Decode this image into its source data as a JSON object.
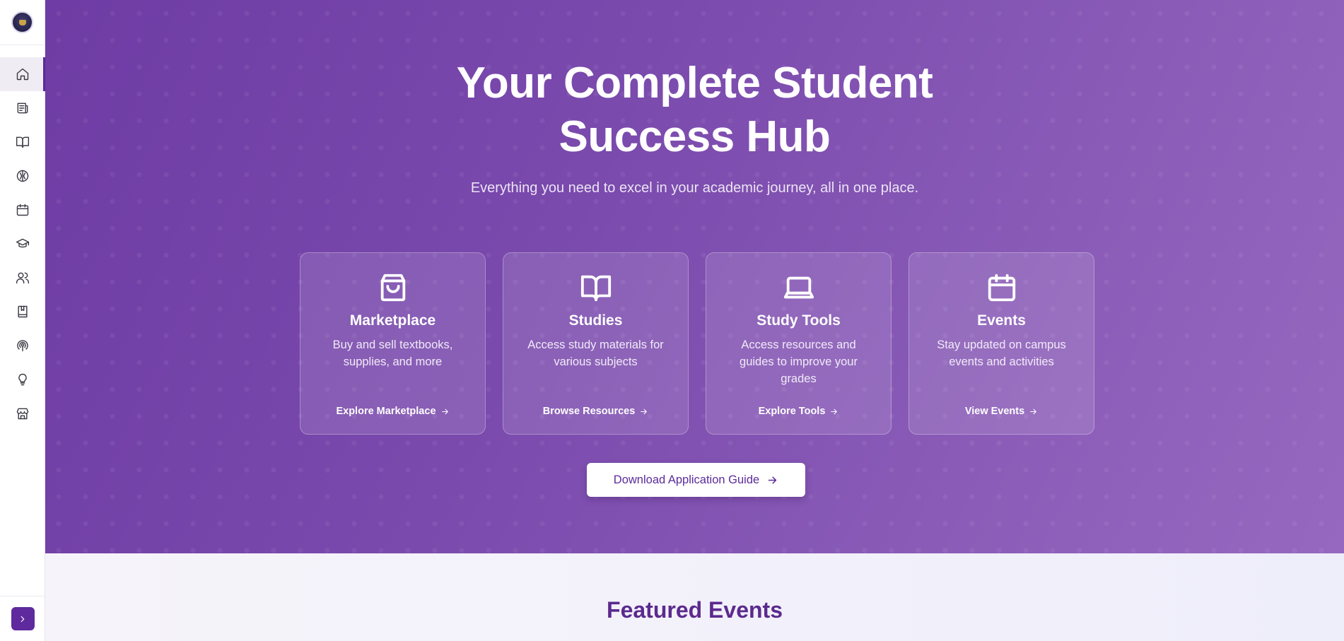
{
  "sidebar": {
    "logo_icon": "university-crest-logo",
    "items": [
      {
        "name": "home",
        "icon": "home-icon",
        "active": true
      },
      {
        "name": "news",
        "icon": "newspaper-icon",
        "active": false
      },
      {
        "name": "studies",
        "icon": "book-open-icon",
        "active": false
      },
      {
        "name": "brain",
        "icon": "brain-icon",
        "active": false
      },
      {
        "name": "calendar",
        "icon": "calendar-icon",
        "active": false
      },
      {
        "name": "graduation",
        "icon": "graduation-cap-icon",
        "active": false
      },
      {
        "name": "users",
        "icon": "users-icon",
        "active": false
      },
      {
        "name": "bookmark-book",
        "icon": "book-bookmark-icon",
        "active": false
      },
      {
        "name": "podcast",
        "icon": "podcast-icon",
        "active": false
      },
      {
        "name": "ideas",
        "icon": "lightbulb-icon",
        "active": false
      },
      {
        "name": "store",
        "icon": "store-icon",
        "active": false
      }
    ],
    "expand_icon": "chevron-right-icon"
  },
  "hero": {
    "title_line1": "Your Complete Student",
    "title_line2": "Success Hub",
    "subtitle": "Everything you need to excel in your academic journey, all in one place.",
    "cards": [
      {
        "icon": "shopping-bag-icon",
        "title": "Marketplace",
        "description": "Buy and sell textbooks, supplies, and more",
        "link": "Explore Marketplace"
      },
      {
        "icon": "book-open-icon",
        "title": "Studies",
        "description": "Access study materials for various subjects",
        "link": "Browse Resources"
      },
      {
        "icon": "laptop-icon",
        "title": "Study Tools",
        "description": "Access resources and guides to improve your grades",
        "link": "Explore Tools"
      },
      {
        "icon": "calendar-icon",
        "title": "Events",
        "description": "Stay updated on campus events and activities",
        "link": "View Events"
      }
    ],
    "guide_button": "Download Application Guide"
  },
  "featured": {
    "title": "Featured Events"
  },
  "colors": {
    "accent": "#5b2a9a",
    "hero_start": "#6e3ca4",
    "hero_end": "#9668bf"
  }
}
